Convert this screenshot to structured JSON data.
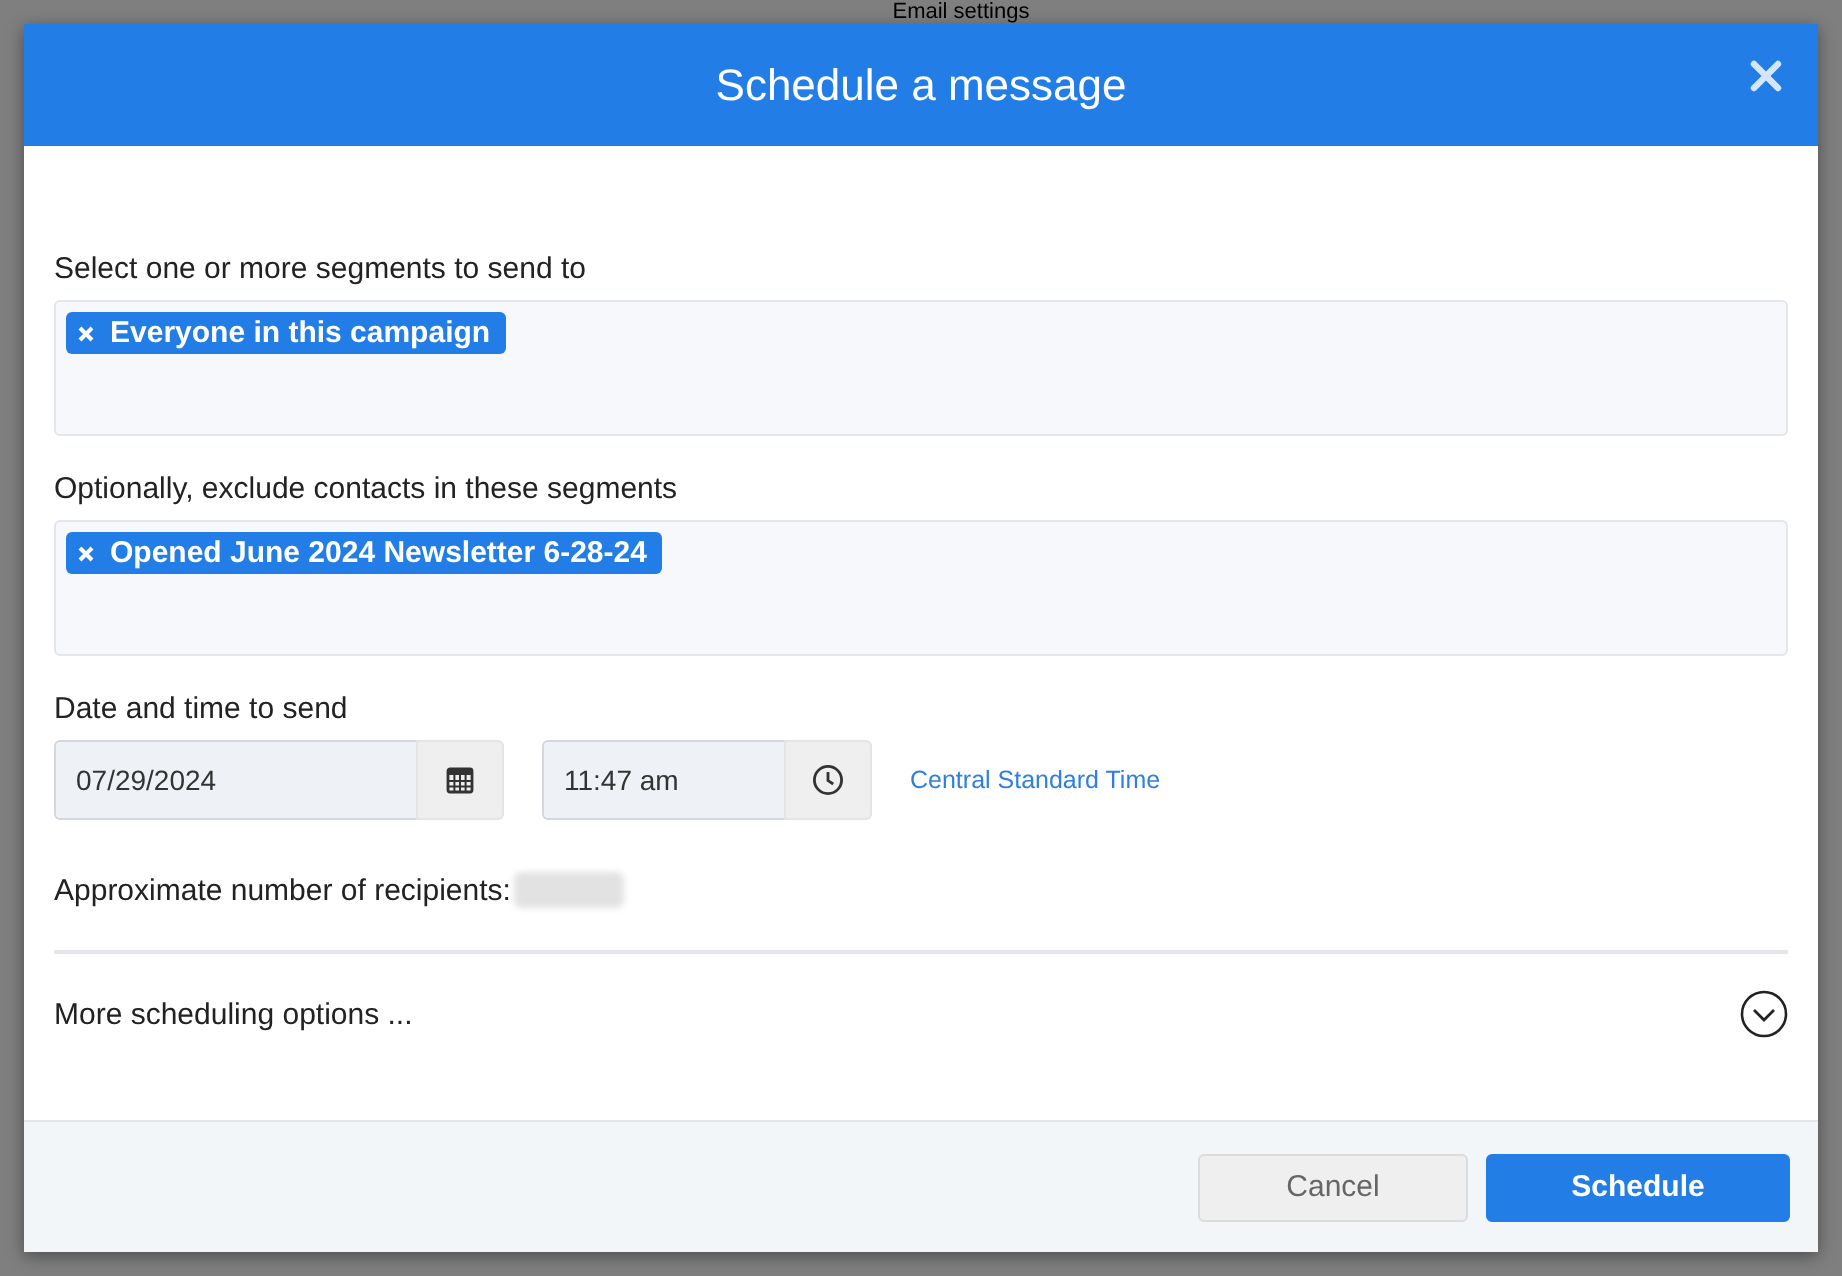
{
  "page": {
    "title": "Email settings"
  },
  "dialog": {
    "title": "Schedule a message",
    "segments": {
      "label": "Select one or more segments to send to",
      "tags": [
        "Everyone in this campaign"
      ]
    },
    "exclude": {
      "label": "Optionally, exclude contacts in these segments",
      "tags": [
        "Opened June 2024 Newsletter 6-28-24"
      ]
    },
    "datetime": {
      "label": "Date and time to send",
      "date": "07/29/2024",
      "time": "11:47 am",
      "timezone": "Central Standard Time"
    },
    "recipients": {
      "label": "Approximate number of recipients:",
      "value_hidden": true
    },
    "more_options": {
      "label": "More scheduling options ...",
      "expanded": false
    },
    "buttons": [
      {
        "label": "Cancel",
        "kind": "secondary"
      },
      {
        "label": "Schedule",
        "kind": "primary"
      }
    ]
  }
}
